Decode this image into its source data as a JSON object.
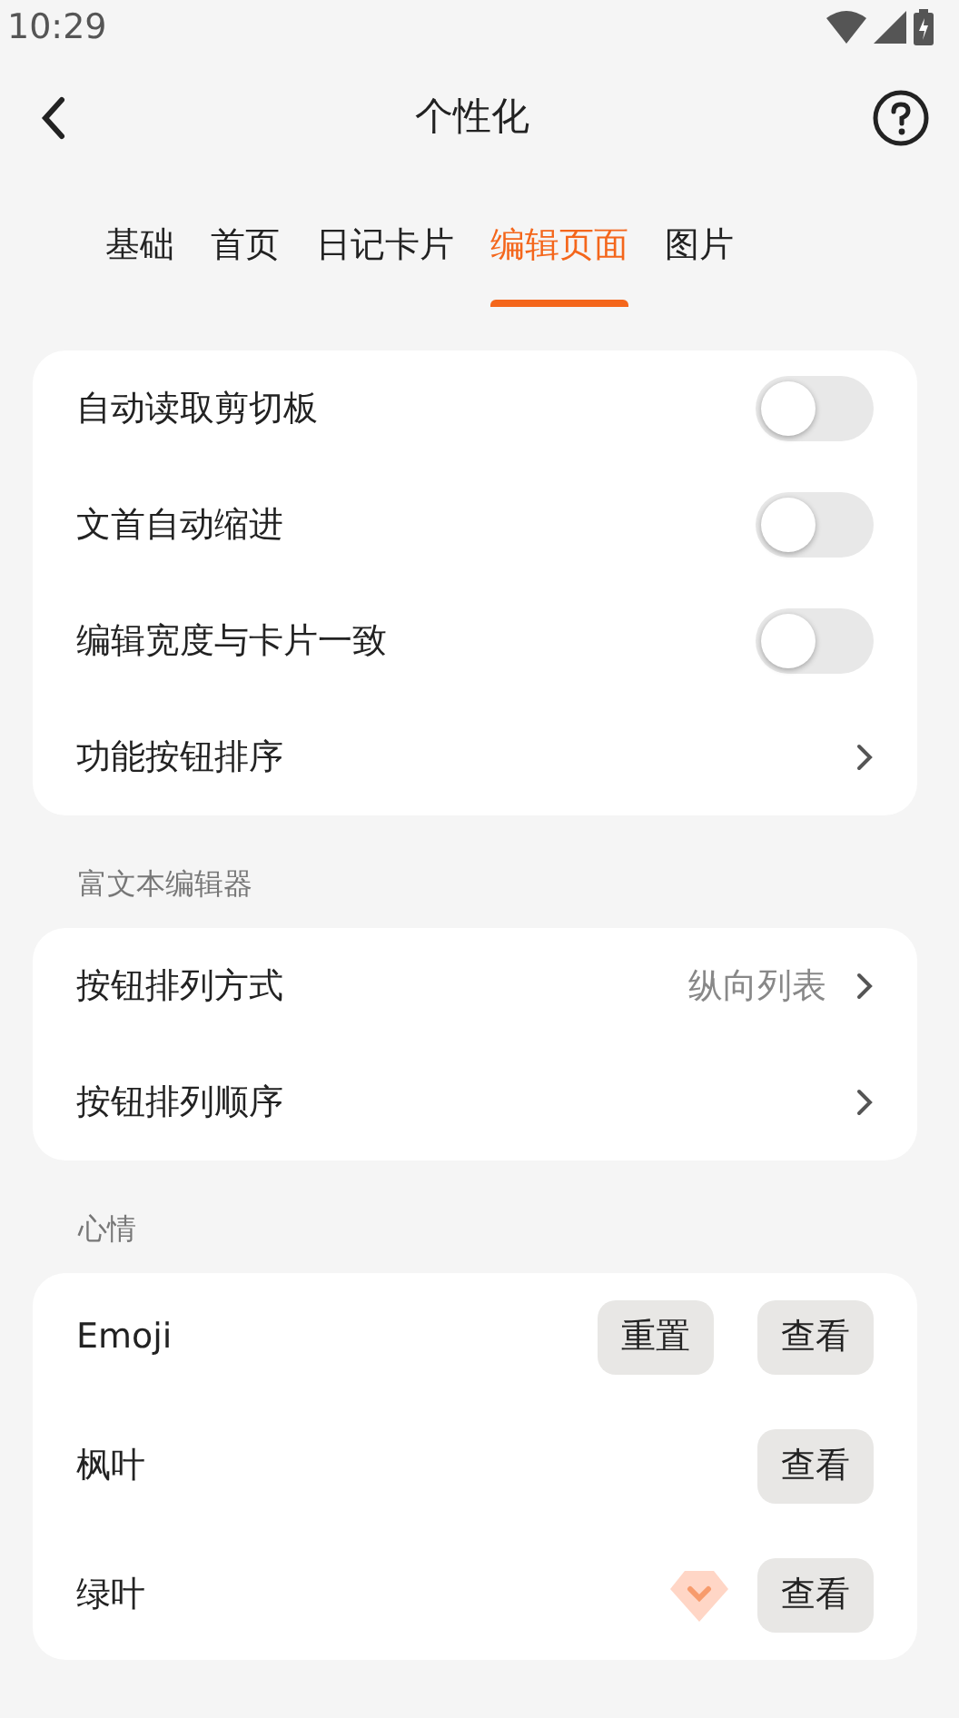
{
  "status_bar": {
    "time": "10:29"
  },
  "app_bar": {
    "title": "个性化"
  },
  "tabs": [
    {
      "label": "基础",
      "selected": false
    },
    {
      "label": "首页",
      "selected": false
    },
    {
      "label": "日记卡片",
      "selected": false
    },
    {
      "label": "编辑页面",
      "selected": true
    },
    {
      "label": "图片",
      "selected": false
    }
  ],
  "sections": [
    {
      "rows": [
        {
          "kind": "toggle",
          "label": "自动读取剪切板",
          "on": false
        },
        {
          "kind": "toggle",
          "label": "文首自动缩进",
          "on": false
        },
        {
          "kind": "toggle",
          "label": "编辑宽度与卡片一致",
          "on": false
        },
        {
          "kind": "link",
          "label": "功能按钮排序"
        }
      ]
    },
    {
      "header": "富文本编辑器",
      "rows": [
        {
          "kind": "link",
          "label": "按钮排列方式",
          "value": "纵向列表"
        },
        {
          "kind": "link",
          "label": "按钮排列顺序"
        }
      ]
    },
    {
      "header": "心情",
      "rows": [
        {
          "kind": "actions",
          "label": "Emoji",
          "buttons": [
            "重置",
            "查看"
          ]
        },
        {
          "kind": "actions",
          "label": "枫叶",
          "buttons": [
            "查看"
          ]
        },
        {
          "kind": "actions",
          "label": "绿叶",
          "premium": true,
          "buttons": [
            "查看"
          ]
        }
      ]
    }
  ]
}
